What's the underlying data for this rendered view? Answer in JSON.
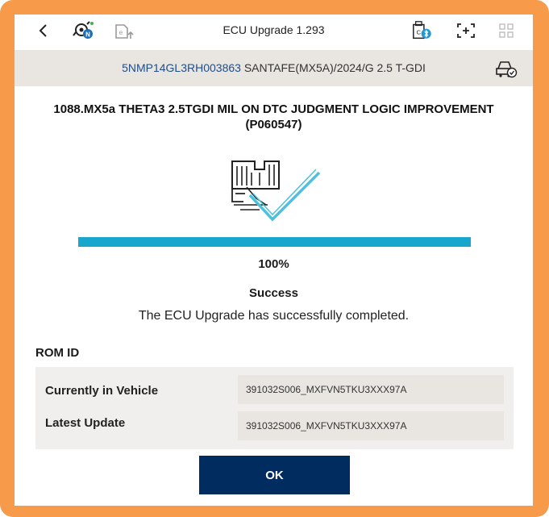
{
  "header": {
    "title": "ECU Upgrade 1.293",
    "icons": [
      "back-icon",
      "gear-n-icon",
      "ecu-upload-icon",
      "vci-bluetooth-icon",
      "screen-capture-icon",
      "grid-icon"
    ]
  },
  "vehicle": {
    "vin": "5NMP14GL3RH003863",
    "model": "SANTAFE(MX5A)/2024/G 2.5 T-GDI"
  },
  "upgrade": {
    "title": "1088.MX5a THETA3 2.5TGDI MIL ON DTC JUDGMENT LOGIC IMPROVEMENT (P060547)",
    "progress_percent": 100,
    "progress_label": "100%",
    "status": "Success",
    "message": "The ECU Upgrade has successfully completed."
  },
  "rom": {
    "label": "ROM ID",
    "rows": [
      {
        "label": "Currently in Vehicle",
        "value": "391032S006_MXFVN5TKU3XXX97A"
      },
      {
        "label": "Latest Update",
        "value": "391032S006_MXFVN5TKU3XXX97A"
      }
    ]
  },
  "actions": {
    "ok_label": "OK"
  },
  "colors": {
    "frame": "#f79a49",
    "progress": "#19a6cc",
    "button": "#002c5f",
    "vin": "#1f4e8a",
    "check": "#4cc1dd"
  }
}
